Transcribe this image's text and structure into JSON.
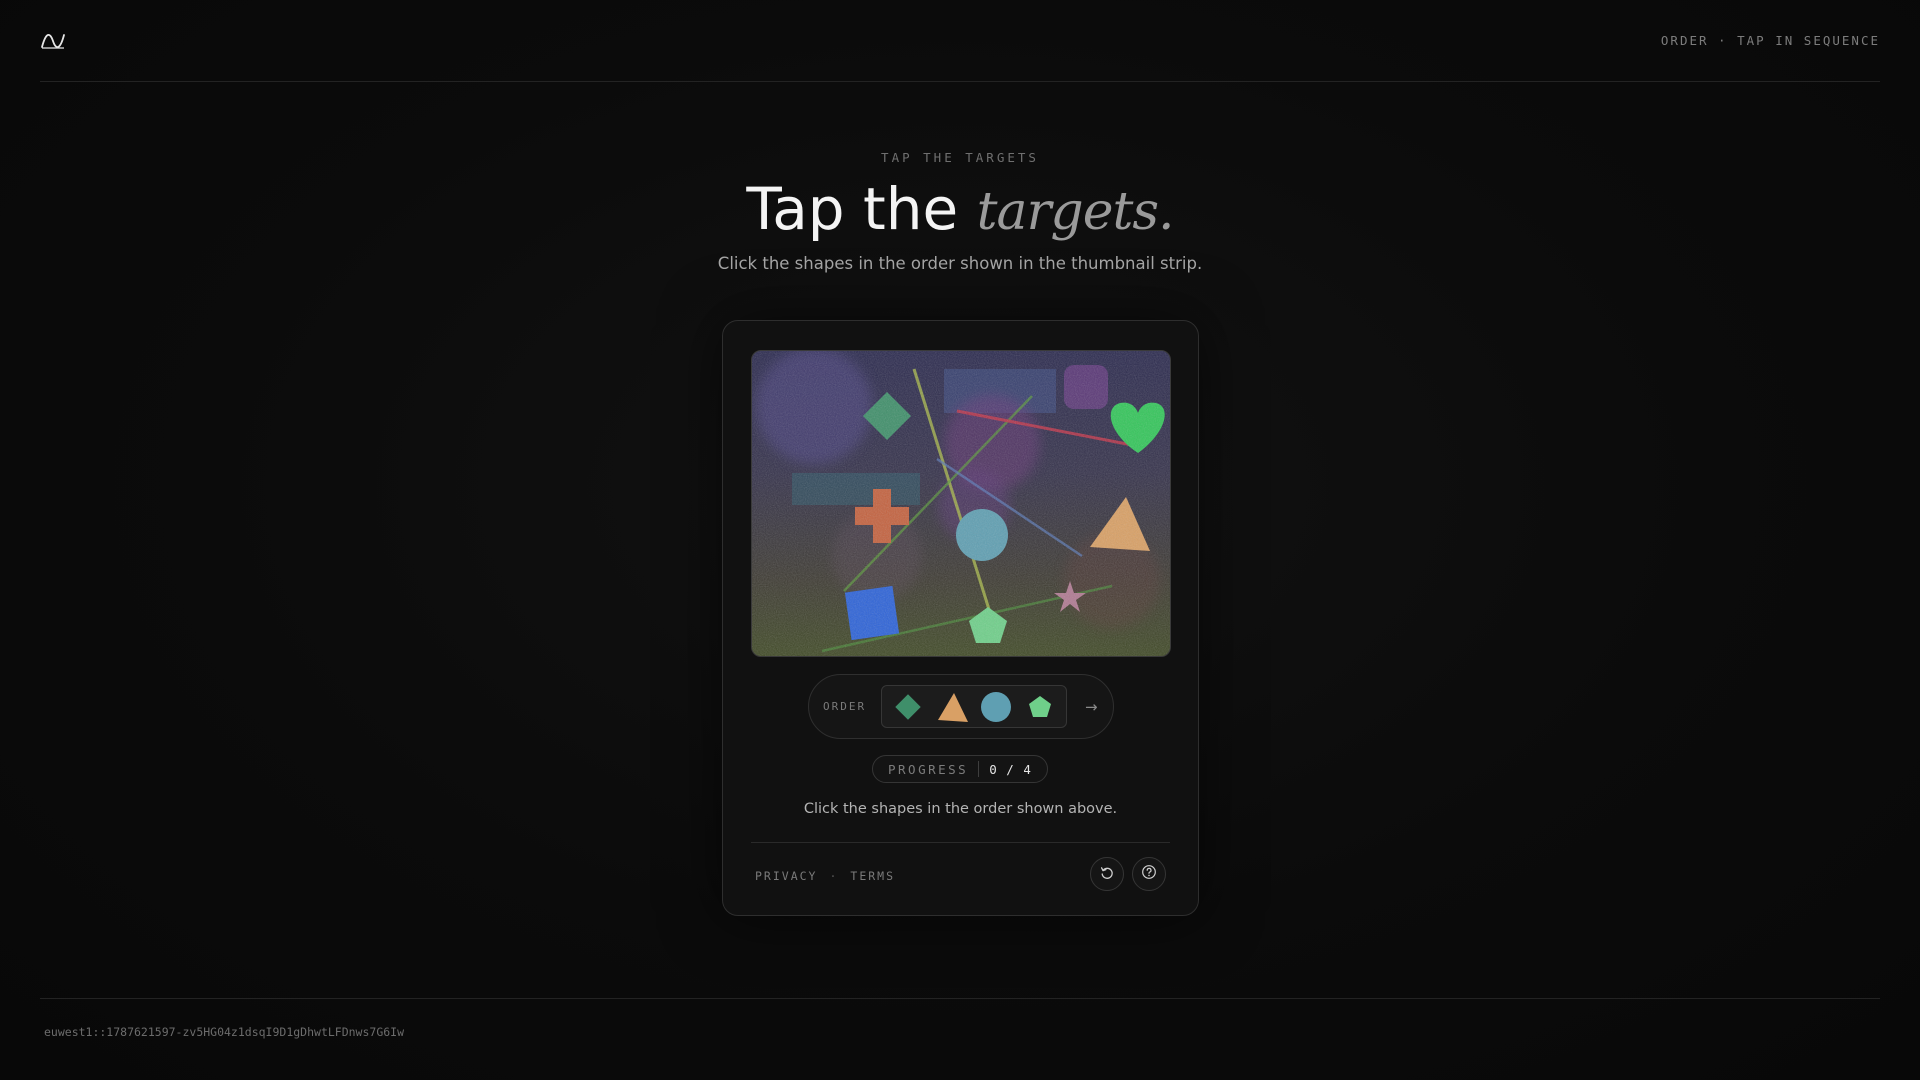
{
  "header": {
    "logo_icon": "wave-logo-icon",
    "status_text": "ORDER · TAP IN SEQUENCE"
  },
  "hero": {
    "eyebrow": "TAP THE TARGETS",
    "title_plain": "Tap the ",
    "title_accent": "targets.",
    "subtitle": "Click the shapes in the order shown in the thumbnail strip."
  },
  "challenge": {
    "canvas_shapes": [
      {
        "name": "green-diamond-shape",
        "kind": "diamond",
        "color": "#3f8f6a"
      },
      {
        "name": "green-heart-shape",
        "kind": "heart",
        "color": "#33c65a"
      },
      {
        "name": "orange-cross-shape",
        "kind": "cross",
        "color": "#c4623f"
      },
      {
        "name": "blue-circle-shape",
        "kind": "circle",
        "color": "#5f9fb2"
      },
      {
        "name": "orange-triangle-shape",
        "kind": "triangle",
        "color": "#d9a065"
      },
      {
        "name": "blue-square-shape",
        "kind": "square",
        "color": "#2d63d8"
      },
      {
        "name": "green-pentagon-shape",
        "kind": "pentagon",
        "color": "#6fd08a"
      },
      {
        "name": "pink-star-shape",
        "kind": "star",
        "color": "#b07a92"
      }
    ],
    "order_label": "ORDER",
    "order_thumbs": [
      {
        "name": "thumb-diamond-icon",
        "color": "#3f8f6a"
      },
      {
        "name": "thumb-triangle-icon",
        "color": "#d9a065"
      },
      {
        "name": "thumb-circle-icon",
        "color": "#5f9fb2"
      },
      {
        "name": "thumb-pentagon-icon",
        "color": "#6fd08a"
      }
    ],
    "next_icon": "arrow-right-icon",
    "next_glyph": "→",
    "progress_label": "PROGRESS",
    "progress_value": "0 / 4",
    "progress_done": 0,
    "progress_total": 4,
    "hint": "Click the shapes in the order shown above."
  },
  "footer_links": {
    "privacy": "PRIVACY",
    "separator": "·",
    "terms": "TERMS"
  },
  "card_icons": {
    "refresh": "refresh-icon",
    "help": "help-icon"
  },
  "footer": {
    "session_id": "euwest1::1787621597-zv5HG04z1dsqI9D1gDhwtLFDnws7G6Iw"
  }
}
